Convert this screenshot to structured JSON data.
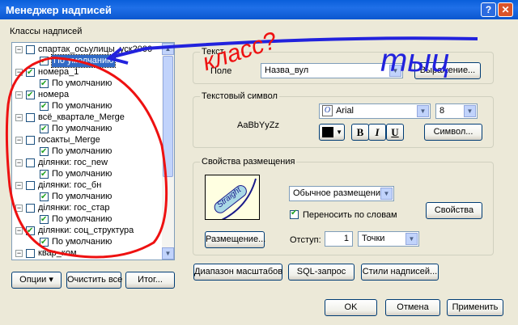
{
  "window": {
    "title": "Менеджер надписей",
    "help_glyph": "?",
    "close_glyph": "✕"
  },
  "tree": {
    "label": "Классы надписей",
    "items": [
      {
        "label": "спартак_осьулицы_уск2000",
        "level": 0,
        "checked": false,
        "expanded": true
      },
      {
        "label": "По умолчанию",
        "level": 1,
        "checked": true,
        "selected": true
      },
      {
        "label": "номера_1",
        "level": 0,
        "checked": true,
        "expanded": true
      },
      {
        "label": "По умолчанию",
        "level": 1,
        "checked": true
      },
      {
        "label": "номера",
        "level": 0,
        "checked": true,
        "expanded": true
      },
      {
        "label": "По умолчанию",
        "level": 1,
        "checked": true
      },
      {
        "label": "всё_квартале_Merge",
        "level": 0,
        "checked": false,
        "expanded": true
      },
      {
        "label": "По умолчанию",
        "level": 1,
        "checked": true
      },
      {
        "label": "госакты_Merge",
        "level": 0,
        "checked": false,
        "expanded": true
      },
      {
        "label": "По умолчанию",
        "level": 1,
        "checked": true
      },
      {
        "label": "ділянки: гос_new",
        "level": 0,
        "checked": false,
        "expanded": true
      },
      {
        "label": "По умолчанию",
        "level": 1,
        "checked": true
      },
      {
        "label": "ділянки: гос_бн",
        "level": 0,
        "checked": false,
        "expanded": true
      },
      {
        "label": "По умолчанию",
        "level": 1,
        "checked": true
      },
      {
        "label": "ділянки: гос_стар",
        "level": 0,
        "checked": false,
        "expanded": true
      },
      {
        "label": "По умолчанию",
        "level": 1,
        "checked": true
      },
      {
        "label": "ділянки: соц_структура",
        "level": 0,
        "checked": true,
        "expanded": true
      },
      {
        "label": "По умолчанию",
        "level": 1,
        "checked": true
      },
      {
        "label": "квар_ком",
        "level": 0,
        "checked": false,
        "expanded": true
      }
    ]
  },
  "bottom_left": {
    "options_label": "Опции",
    "clear_label": "Очистить все",
    "total_label": "Итог..."
  },
  "text_group": {
    "title": "Текст",
    "field_label": "Поле",
    "field_value": "Назва_вул",
    "expression_label": "Выражение..."
  },
  "symbol_group": {
    "title": "Текстовый символ",
    "sample": "AaBbYyZz",
    "font_value": "Arial",
    "size_value": "8",
    "bold_label": "B",
    "italic_label": "I",
    "underline_label": "U",
    "symbol_label": "Символ...",
    "font_color": "#000000"
  },
  "placement_group": {
    "title": "Свойства размещения",
    "preview_text": "Straight",
    "placement_value": "Обычное размещение",
    "wrap_label": "Переносить по словам",
    "wrap_checked": true,
    "properties_label": "Свойства",
    "placement_button": "Размещение...",
    "offset_label": "Отступ:",
    "offset_value": "1",
    "units_value": "Точки"
  },
  "bottom_right": {
    "scale_range": "Диапазон масштабов",
    "sql_query": "SQL-запрос",
    "label_styles": "Стили надписей..."
  },
  "footer": {
    "ok": "OK",
    "cancel": "Отмена",
    "apply": "Применить"
  },
  "annotations": {
    "handwritten_1": "класс?",
    "handwritten_2": "тыц",
    "ink_color": "#2222DD",
    "red_color": "#EE1111"
  }
}
